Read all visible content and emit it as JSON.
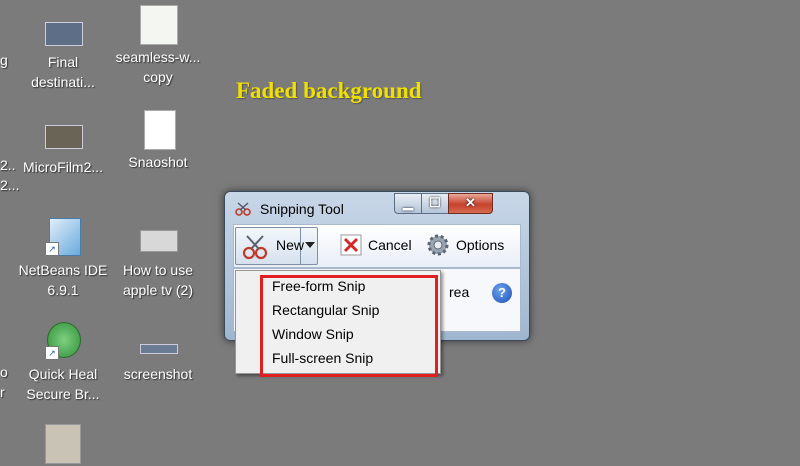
{
  "desktop": {
    "heading": "Faded background",
    "partial_texts": [
      "g",
      "2..",
      "2...",
      "o",
      "r"
    ],
    "icons": [
      {
        "label": "Final\ndestinati...",
        "icon": "video-icon"
      },
      {
        "label": "seamless-w...\ncopy",
        "icon": "image-icon"
      },
      {
        "label": "MicroFilm2...",
        "icon": "video-icon"
      },
      {
        "label": "Snaoshot",
        "icon": "document-icon"
      },
      {
        "label": "NetBeans IDE\n6.9.1",
        "icon": "netbeans-icon"
      },
      {
        "label": "How to use\napple tv (2)",
        "icon": "video-icon"
      },
      {
        "label": "Quick Heal\nSecure Br...",
        "icon": "quickheal-icon"
      },
      {
        "label": "screenshot",
        "icon": "video-icon"
      },
      {
        "label": "",
        "icon": "image-icon"
      }
    ]
  },
  "window": {
    "title": "Snipping Tool",
    "controls": {
      "minimize": "▁",
      "maximize": "☐",
      "close": "✕"
    },
    "toolbar": {
      "new_label": "New",
      "cancel_label": "Cancel",
      "options_label": "Options"
    },
    "content": {
      "mode_text": "rea",
      "help_glyph": "?"
    }
  },
  "menu": {
    "items": [
      "Free-form Snip",
      "Rectangular Snip",
      "Window Snip",
      "Full-screen Snip"
    ]
  },
  "colors": {
    "desktop_bg": "#7b7b7b",
    "heading": "#f0e000",
    "highlight": "#e02020"
  }
}
